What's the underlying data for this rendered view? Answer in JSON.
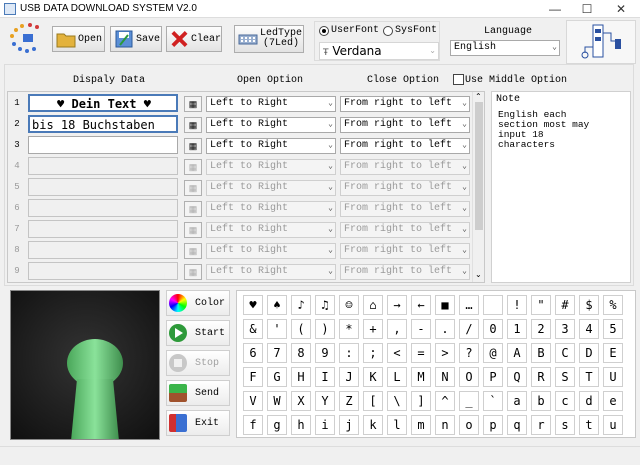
{
  "window": {
    "title": "USB DATA DOWNLOAD SYSTEM V2.0",
    "min": "—",
    "max": "☐",
    "close": "✕"
  },
  "toolbar": {
    "open": "Open",
    "save": "Save",
    "clear": "Clear",
    "ledtype_1": "LedType",
    "ledtype_2": "(7Led)"
  },
  "font": {
    "user_font": "UserFont",
    "sys_font": "SysFont",
    "font_value": "Verdana",
    "selected": "UserFont"
  },
  "language": {
    "label": "Language",
    "value": "English"
  },
  "headers": {
    "display": "Dispaly Data",
    "open": "Open Option",
    "close": "Close Option",
    "middle": "Use Middle Option"
  },
  "rows": [
    {
      "num": "1",
      "text": "♥ Dein Text ♥",
      "open": "Left to Right",
      "close": "From right to left",
      "enabled": true
    },
    {
      "num": "2",
      "text": "bis 18 Buchstaben",
      "open": "Left to Right",
      "close": "From right to left",
      "enabled": true
    },
    {
      "num": "3",
      "text": "",
      "open": "Left to Right",
      "close": "From right to left",
      "enabled": true
    },
    {
      "num": "4",
      "text": "",
      "open": "Left to Right",
      "close": "From right to left",
      "enabled": false
    },
    {
      "num": "5",
      "text": "",
      "open": "Left to Right",
      "close": "From right to left",
      "enabled": false
    },
    {
      "num": "6",
      "text": "",
      "open": "Left to Right",
      "close": "From right to left",
      "enabled": false
    },
    {
      "num": "7",
      "text": "",
      "open": "Left to Right",
      "close": "From right to left",
      "enabled": false
    },
    {
      "num": "8",
      "text": "",
      "open": "Left to Right",
      "close": "From right to left",
      "enabled": false
    },
    {
      "num": "9",
      "text": "",
      "open": "Left to Right",
      "close": "From right to left",
      "enabled": false
    }
  ],
  "note": {
    "title": "Note",
    "text": "English each section most may input 18 characters"
  },
  "side": {
    "color": "Color",
    "start": "Start",
    "stop": "Stop",
    "send": "Send",
    "exit": "Exit"
  },
  "keys": [
    [
      "♥",
      "♠",
      "♪",
      "♫",
      "☺",
      "⌂",
      "→",
      "←",
      "■",
      "…",
      "",
      "!",
      "\"",
      "#",
      "$",
      "%"
    ],
    [
      "&",
      "'",
      "(",
      ")",
      "*",
      "+",
      ",",
      "-",
      ".",
      "/",
      "0",
      "1",
      "2",
      "3",
      "4",
      "5"
    ],
    [
      "6",
      "7",
      "8",
      "9",
      ":",
      ";",
      "<",
      "=",
      ">",
      "?",
      "@",
      "A",
      "B",
      "C",
      "D",
      "E"
    ],
    [
      "F",
      "G",
      "H",
      "I",
      "J",
      "K",
      "L",
      "M",
      "N",
      "O",
      "P",
      "Q",
      "R",
      "S",
      "T",
      "U"
    ],
    [
      "V",
      "W",
      "X",
      "Y",
      "Z",
      "[",
      "\\",
      "]",
      "^",
      "_",
      "`",
      "a",
      "b",
      "c",
      "d",
      "e"
    ],
    [
      "f",
      "g",
      "h",
      "i",
      "j",
      "k",
      "l",
      "m",
      "n",
      "o",
      "p",
      "q",
      "r",
      "s",
      "t",
      "u"
    ]
  ],
  "colors": {
    "fan": "#6fcf7f",
    "accent": "#4a7ab8"
  }
}
